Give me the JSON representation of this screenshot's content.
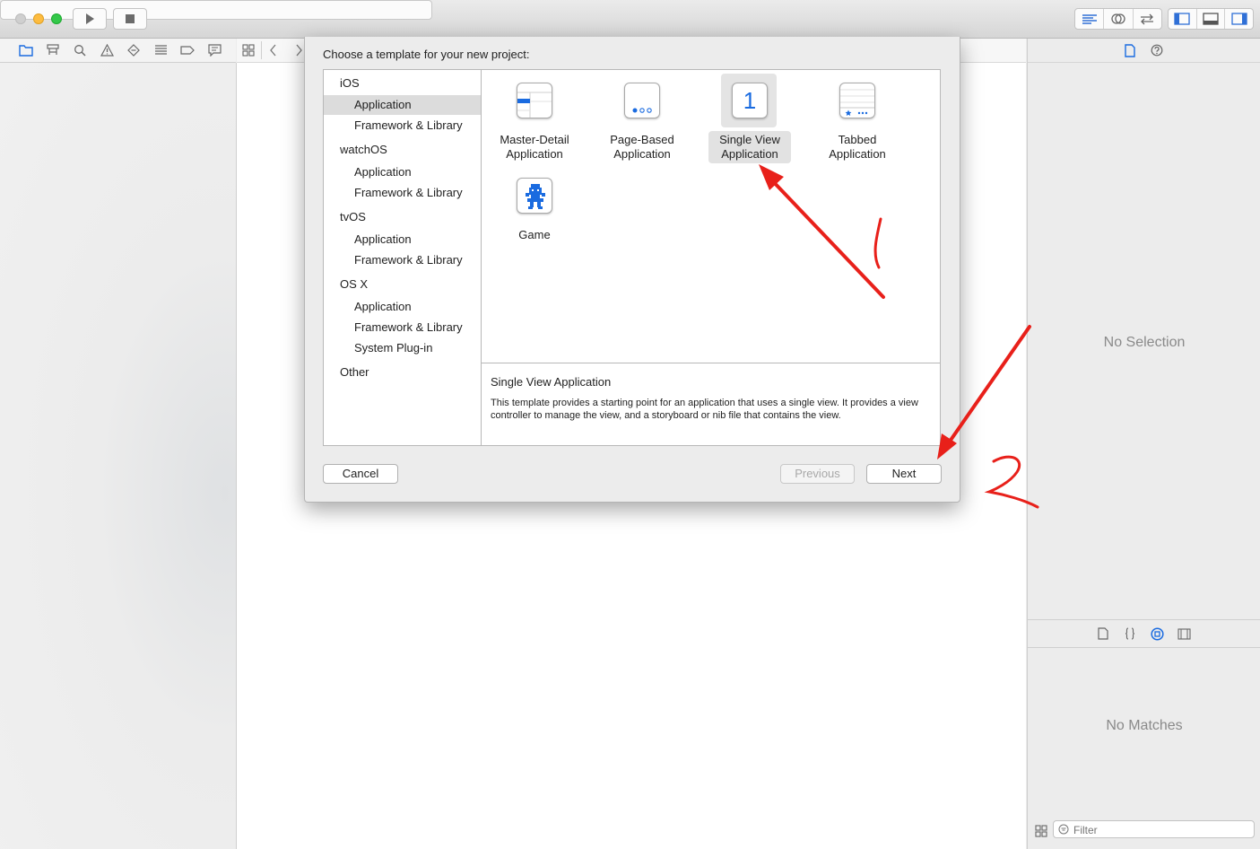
{
  "inspector": {
    "no_selection": "No Selection",
    "no_matches": "No Matches",
    "filter_placeholder": "Filter"
  },
  "dialog": {
    "title": "Choose a template for your new project:",
    "sidebar": {
      "ios": "iOS",
      "ios_application": "Application",
      "ios_framework": "Framework & Library",
      "watchos": "watchOS",
      "watchos_application": "Application",
      "watchos_framework": "Framework & Library",
      "tvos": "tvOS",
      "tvos_application": "Application",
      "tvos_framework": "Framework & Library",
      "osx": "OS X",
      "osx_application": "Application",
      "osx_framework": "Framework & Library",
      "osx_plugin": "System Plug-in",
      "other": "Other"
    },
    "templates": {
      "master_detail": "Master-Detail\nApplication",
      "page_based": "Page-Based\nApplication",
      "single_view": "Single View\nApplication",
      "tabbed": "Tabbed\nApplication",
      "game": "Game",
      "single_view_icon_text": "1"
    },
    "description": {
      "title": "Single View Application",
      "text": "This template provides a starting point for an application that uses a single view. It provides a view controller to manage the view, and a storyboard or nib file that contains the view."
    },
    "buttons": {
      "cancel": "Cancel",
      "previous": "Previous",
      "next": "Next"
    }
  },
  "annotations": {
    "mark_1": "1",
    "mark_2": "2",
    "color": "#e8201a"
  },
  "colors": {
    "accent": "#1a6be0",
    "selection": "#dcdcdc"
  }
}
